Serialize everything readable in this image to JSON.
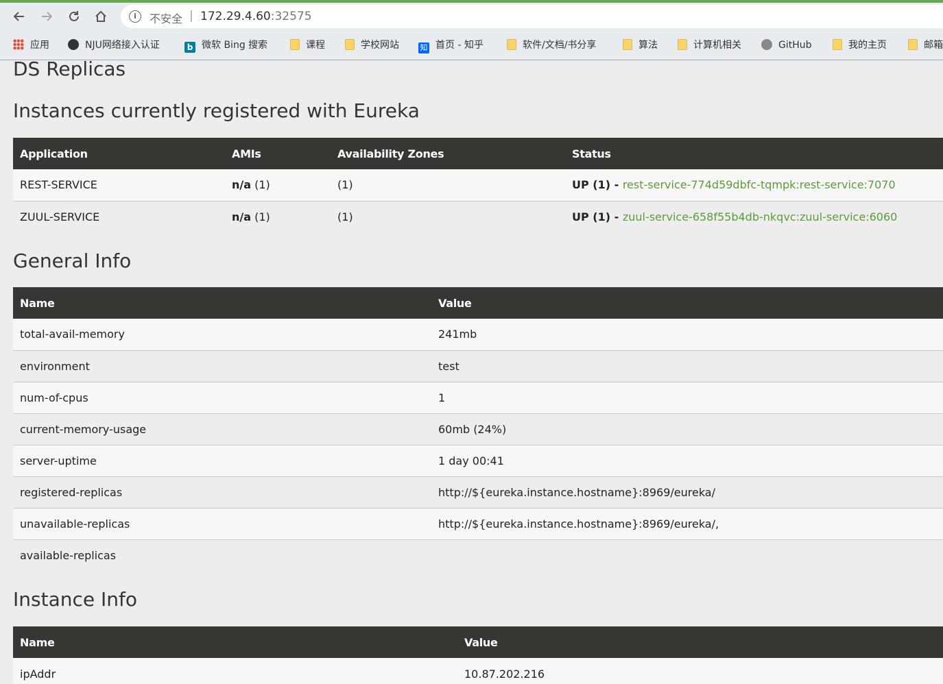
{
  "browser": {
    "security_label": "不安全",
    "url_host": "172.29.4.60",
    "url_port": ":32575",
    "bookmarks": [
      {
        "label": "应用",
        "icon": "apps-icon"
      },
      {
        "label": "NJU网络接入认证",
        "icon": "globe-icon"
      },
      {
        "label": "微软 Bing 搜索",
        "icon": "bing-icon"
      },
      {
        "label": "课程",
        "icon": "folder-icon"
      },
      {
        "label": "学校网站",
        "icon": "folder-icon"
      },
      {
        "label": "首页 - 知乎",
        "icon": "zhihu-icon"
      },
      {
        "label": "软件/文档/书分享",
        "icon": "folder-icon"
      },
      {
        "label": "算法",
        "icon": "folder-icon"
      },
      {
        "label": "计算机相关",
        "icon": "folder-icon"
      },
      {
        "label": "GitHub",
        "icon": "github-icon"
      },
      {
        "label": "我的主页",
        "icon": "folder-icon"
      },
      {
        "label": "邮箱",
        "icon": "folder-icon"
      }
    ]
  },
  "page": {
    "ds_replicas_title": "DS Replicas",
    "instances_title": "Instances currently registered with Eureka",
    "instances_table": {
      "headers": [
        "Application",
        "AMIs",
        "Availability Zones",
        "Status"
      ],
      "rows": [
        {
          "application": "REST-SERVICE",
          "amis_value": "n/a",
          "amis_count": " (1)",
          "zones": "(1)",
          "status_prefix": "UP (1) - ",
          "status_link": "rest-service-774d59dbfc-tqmpk:rest-service:7070"
        },
        {
          "application": "ZUUL-SERVICE",
          "amis_value": "n/a",
          "amis_count": " (1)",
          "zones": "(1)",
          "status_prefix": "UP (1) - ",
          "status_link": "zuul-service-658f55b4db-nkqvc:zuul-service:6060"
        }
      ]
    },
    "general_title": "General Info",
    "general_table": {
      "headers": [
        "Name",
        "Value"
      ],
      "rows": [
        {
          "name": "total-avail-memory",
          "value": "241mb"
        },
        {
          "name": "environment",
          "value": "test"
        },
        {
          "name": "num-of-cpus",
          "value": "1"
        },
        {
          "name": "current-memory-usage",
          "value": "60mb (24%)"
        },
        {
          "name": "server-uptime",
          "value": "1 day 00:41"
        },
        {
          "name": "registered-replicas",
          "value": "http://${eureka.instance.hostname}:8969/eureka/"
        },
        {
          "name": "unavailable-replicas",
          "value": "http://${eureka.instance.hostname}:8969/eureka/,"
        },
        {
          "name": "available-replicas",
          "value": ""
        }
      ]
    },
    "instance_title": "Instance Info",
    "instance_table": {
      "headers": [
        "Name",
        "Value"
      ],
      "rows": [
        {
          "name": "ipAddr",
          "value": "10.87.202.216"
        }
      ]
    }
  }
}
